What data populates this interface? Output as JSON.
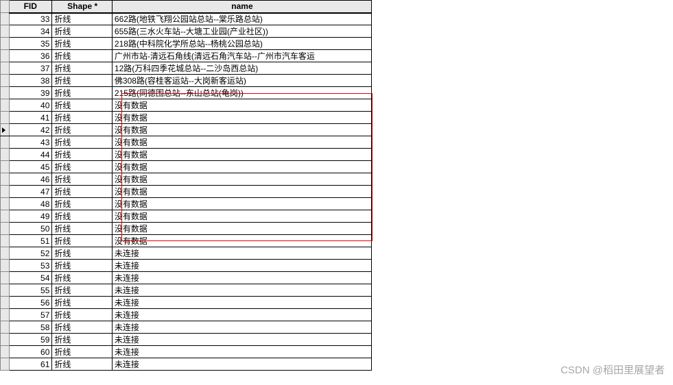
{
  "headers": {
    "fid": "FID",
    "shape": "Shape *",
    "name": "name"
  },
  "selected_fid": 42,
  "highlight": {
    "from_fid": 40,
    "to_fid": 51
  },
  "shape_value": "折线",
  "rows": [
    {
      "fid": 33,
      "name": "662路(地铁飞翔公园站总站--棠乐路总站)"
    },
    {
      "fid": 34,
      "name": "655路(三水火车站--大塘工业园(产业社区))"
    },
    {
      "fid": 35,
      "name": "218路(中科院化学所总站--杨桃公园总站)"
    },
    {
      "fid": 36,
      "name": "广州市站-清远石角线(清远石角汽车站--广州市汽车客运"
    },
    {
      "fid": 37,
      "name": "12路(万科四季花城总站--二沙岛西总站)"
    },
    {
      "fid": 38,
      "name": "佛308路(容桂客运站--大岗新客运站)"
    },
    {
      "fid": 39,
      "name": "215路(同德围总站--东山总站(龟岗))"
    },
    {
      "fid": 40,
      "name": "没有数据"
    },
    {
      "fid": 41,
      "name": "没有数据"
    },
    {
      "fid": 42,
      "name": "没有数据"
    },
    {
      "fid": 43,
      "name": "没有数据"
    },
    {
      "fid": 44,
      "name": "没有数据"
    },
    {
      "fid": 45,
      "name": "没有数据"
    },
    {
      "fid": 46,
      "name": "没有数据"
    },
    {
      "fid": 47,
      "name": "没有数据"
    },
    {
      "fid": 48,
      "name": "没有数据"
    },
    {
      "fid": 49,
      "name": "没有数据"
    },
    {
      "fid": 50,
      "name": "没有数据"
    },
    {
      "fid": 51,
      "name": "没有数据"
    },
    {
      "fid": 52,
      "name": "未连接"
    },
    {
      "fid": 53,
      "name": "未连接"
    },
    {
      "fid": 54,
      "name": "未连接"
    },
    {
      "fid": 55,
      "name": "未连接"
    },
    {
      "fid": 56,
      "name": "未连接"
    },
    {
      "fid": 57,
      "name": "未连接"
    },
    {
      "fid": 58,
      "name": "未连接"
    },
    {
      "fid": 59,
      "name": "未连接"
    },
    {
      "fid": 60,
      "name": "未连接"
    },
    {
      "fid": 61,
      "name": "未连接"
    }
  ],
  "watermark": "CSDN @稻田里展望者"
}
